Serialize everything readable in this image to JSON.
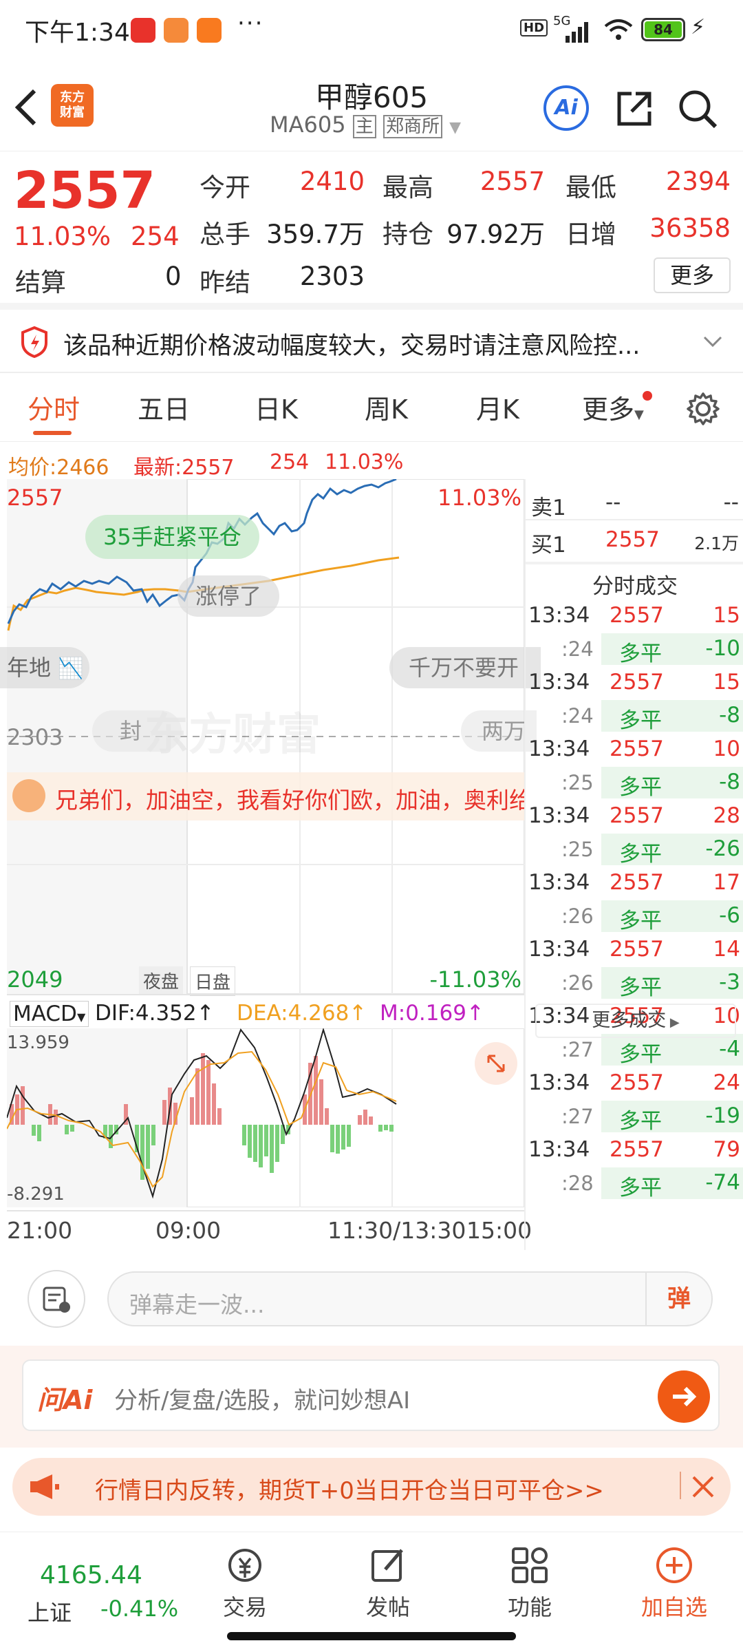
{
  "status_bar": {
    "time": "下午1:34",
    "network": "5G",
    "battery": "84"
  },
  "header": {
    "title": "甲醇605",
    "code": "MA605",
    "main_badge": "主",
    "exchange": "郑商所",
    "logo_text": [
      "东方",
      "财富"
    ]
  },
  "quote": {
    "price": "2557",
    "change_pct": "11.03%",
    "change": "254",
    "settle_label": "结算",
    "settle": "0",
    "prev_settle_label": "昨结",
    "prev_settle": "2303",
    "open_label": "今开",
    "open": "2410",
    "high_label": "最高",
    "high": "2557",
    "low_label": "最低",
    "low": "2394",
    "volume_label": "总手",
    "volume": "359.7万",
    "oi_label": "持仓",
    "oi": "97.92万",
    "daily_inc_label": "日增",
    "daily_inc": "36358",
    "more_button": "更多"
  },
  "warning": {
    "text": "该品种近期价格波动幅度较大，交易时请注意风险控..."
  },
  "tabs": [
    "分时",
    "五日",
    "日K",
    "周K",
    "月K",
    "更多"
  ],
  "info_line": {
    "avg_label": "均价:",
    "avg": "2466",
    "latest_label": "最新:",
    "latest": "2557",
    "change": "254",
    "pct": "11.03%"
  },
  "chart": {
    "price_top": "2557",
    "pct_top": "11.03%",
    "price_mid": "2303",
    "price_bottom": "2049",
    "pct_bottom": "-11.03%",
    "session_night": "夜盘",
    "session_day": "日盘",
    "watermark": "东方财富",
    "bubbles": [
      "35手赶紧平仓",
      "涨停了",
      "千万不要开",
      "封",
      "两万"
    ],
    "bubble_left": "年地",
    "banner": "兄弟们，加油空，我看好你们欧，加油，奥利给"
  },
  "macd": {
    "label": "MACD",
    "dif": "DIF:4.352↑",
    "dea": "DEA:4.268↑",
    "m": "M:0.169↑",
    "max": "13.959",
    "min": "-8.291"
  },
  "time_axis": [
    "21:00",
    "09:00",
    "11:30/13:30",
    "15:00"
  ],
  "orderbook": {
    "sell_label": "卖1",
    "sell_price": "--",
    "sell_vol": "--",
    "buy_label": "买1",
    "buy_price": "2557",
    "buy_vol": "2.1万"
  },
  "trades_title": "分时成交",
  "trades": [
    {
      "time": "13:34",
      "price": "2557",
      "vol": "15",
      "sub_time": ":24",
      "type": "多平",
      "delta": "-10"
    },
    {
      "time": "13:34",
      "price": "2557",
      "vol": "15",
      "sub_time": ":24",
      "type": "多平",
      "delta": "-8"
    },
    {
      "time": "13:34",
      "price": "2557",
      "vol": "10",
      "sub_time": ":25",
      "type": "多平",
      "delta": "-8"
    },
    {
      "time": "13:34",
      "price": "2557",
      "vol": "28",
      "sub_time": ":25",
      "type": "多平",
      "delta": "-26"
    },
    {
      "time": "13:34",
      "price": "2557",
      "vol": "17",
      "sub_time": ":26",
      "type": "多平",
      "delta": "-6"
    },
    {
      "time": "13:34",
      "price": "2557",
      "vol": "14",
      "sub_time": ":26",
      "type": "多平",
      "delta": "-3"
    },
    {
      "time": "13:34",
      "price": "2557",
      "vol": "10",
      "sub_time": ":27",
      "type": "多平",
      "delta": "-4"
    },
    {
      "time": "13:34",
      "price": "2557",
      "vol": "24",
      "sub_time": ":27",
      "type": "多平",
      "delta": "-19"
    },
    {
      "time": "13:34",
      "price": "2557",
      "vol": "79",
      "sub_time": ":28",
      "type": "多平",
      "delta": "-74"
    }
  ],
  "more_trades": "更多成交",
  "danmaku": {
    "placeholder": "弹幕走一波...",
    "button": "弹"
  },
  "ask_ai": {
    "logo": "问Ai",
    "placeholder": "分析/复盘/选股，就问妙想AI"
  },
  "ad": {
    "text": "行情日内反转，期货T+0当日开仓当日可平仓>>"
  },
  "bottom_nav": {
    "index_value": "4165.44",
    "index_name": "上证",
    "index_change": "-0.41%",
    "items": [
      "交易",
      "发帖",
      "功能",
      "加自选"
    ]
  },
  "colors": {
    "up": "#e8322b",
    "down": "#1e9e3a",
    "accent": "#f06a24",
    "price_line": "#2a6db5",
    "avg_line": "#f0a020"
  }
}
